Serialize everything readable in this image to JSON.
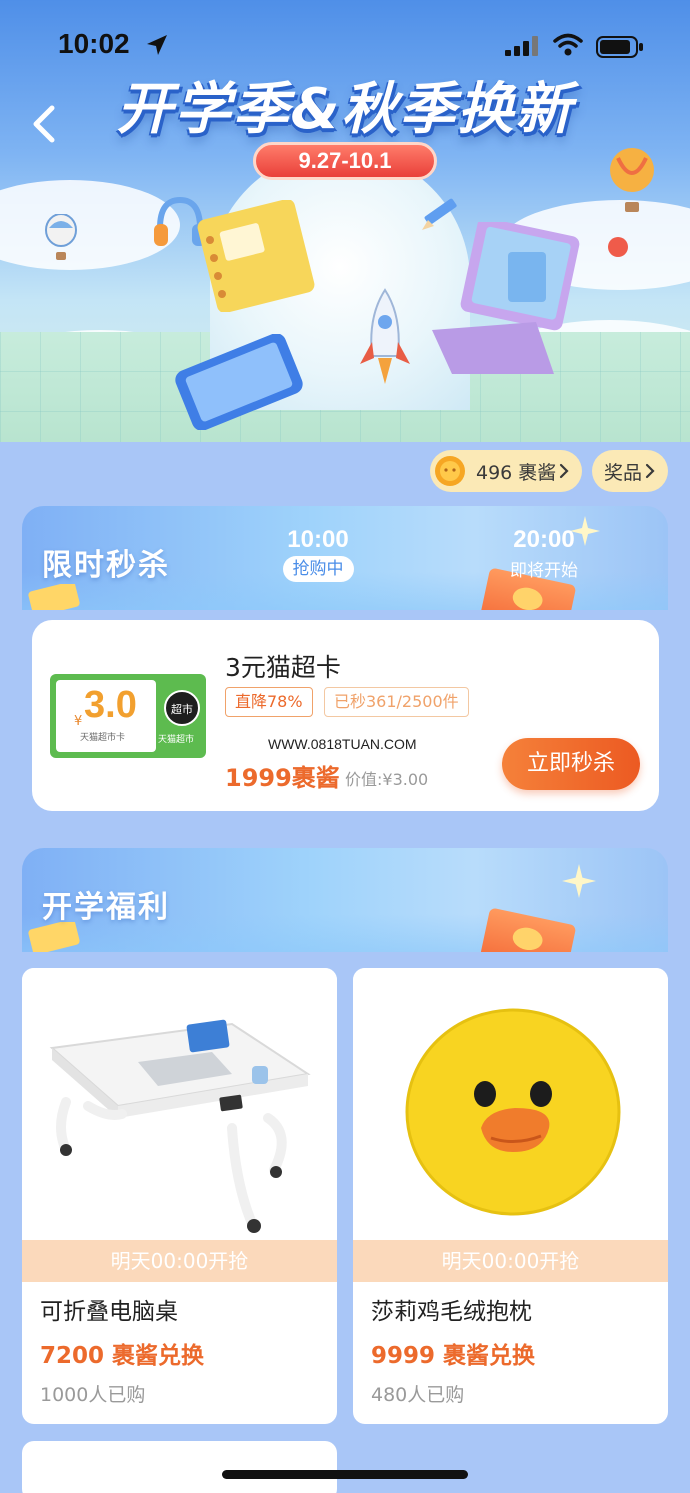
{
  "status_bar": {
    "time": "10:02"
  },
  "banner": {
    "title": "开学季&秋季换新",
    "date_range": "9.27-10.1"
  },
  "points": {
    "balance_label": "496 裹酱",
    "prize_label": "奖品"
  },
  "flash_sale": {
    "title": "限时秒杀",
    "slots": [
      {
        "time": "10:00",
        "status": "抢购中"
      },
      {
        "time": "20:00",
        "status": "即将开始"
      }
    ],
    "item": {
      "voucher_currency": "¥",
      "voucher_amount": "3.0",
      "voucher_caption": "天猫超市卡",
      "voucher_logo": "超市",
      "voucher_brand": "天猫超市",
      "name": "3元猫超卡",
      "tag_discount": "直降78%",
      "tag_sold": "已秒361/2500件",
      "watermark": "WWW.0818TUAN.COM",
      "price": "1999裹酱",
      "worth": "价值:¥3.00",
      "button": "立即秒杀"
    }
  },
  "welfare": {
    "title": "开学福利",
    "products": [
      {
        "bar": "明天00:00开抢",
        "name": "可折叠电脑桌",
        "price": "7200 裹酱兑换",
        "sold": "1000人已购"
      },
      {
        "bar": "明天00:00开抢",
        "name": "莎莉鸡毛绒抱枕",
        "price": "9999 裹酱兑换",
        "sold": "480人已购"
      }
    ]
  },
  "colors": {
    "page_bg": "#a9c6f7",
    "accent_orange": "#ec6a2c",
    "banner_blue": "#4f8fe8",
    "pill_bg": "#fbe9b6"
  },
  "icons": [
    "location-arrow-icon",
    "signal-icon",
    "wifi-icon",
    "battery-icon",
    "back-arrow-icon",
    "coin-icon",
    "chevron-right-icon"
  ]
}
